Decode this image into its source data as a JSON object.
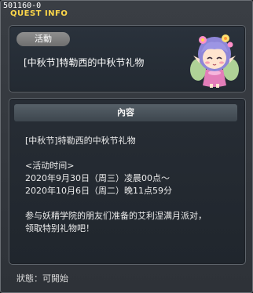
{
  "window": {
    "quest_id": "501160-0",
    "title": "QUEST INFO"
  },
  "summary": {
    "badge_label": "活動",
    "quest_name": "[中秋节]特勒西的中秋节礼物",
    "npc_icon": "fairy-npc-portrait-icon"
  },
  "content": {
    "header": "內容",
    "lines": {
      "quest_name": "[中秋节]特勒西的中秋节礼物",
      "period_label": "<活动时间>",
      "start": "2020年9月30日（周三）凌晨00点～",
      "end": "2020年10月6日（周二）晚11点59分",
      "desc_1": "参与妖精学院的朋友们准备的艾利涅满月派对，",
      "desc_2": "领取特别礼物吧！"
    }
  },
  "status": {
    "text": "狀態：可開始"
  },
  "colors": {
    "title": "#ffd84a",
    "background": "#2e3238",
    "badge": "#7a7a7a",
    "header": "#4a545c"
  }
}
